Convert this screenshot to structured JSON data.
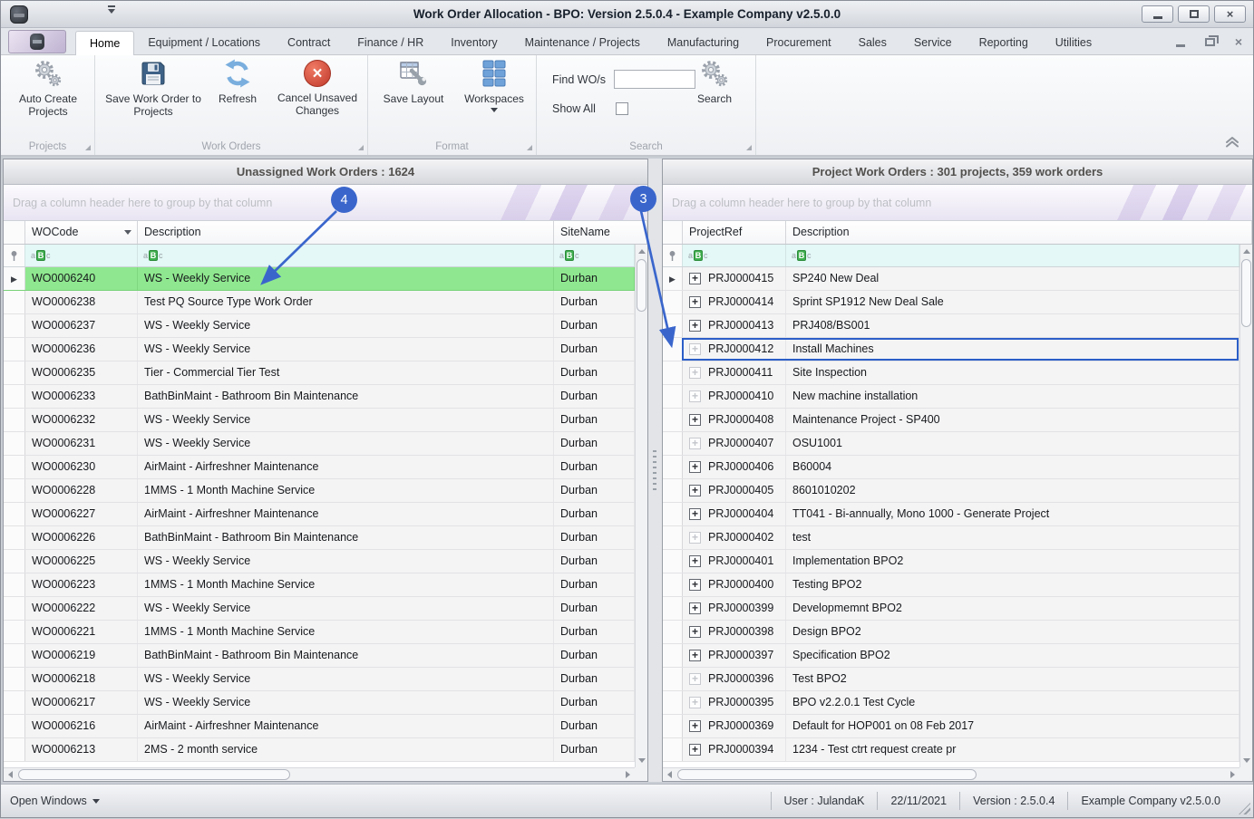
{
  "window": {
    "title": "Work Order Allocation - BPO: Version 2.5.0.4 - Example Company v2.5.0.0"
  },
  "ribbon": {
    "tabs": [
      {
        "label": "Home",
        "selected": true
      },
      {
        "label": "Equipment / Locations"
      },
      {
        "label": "Contract"
      },
      {
        "label": "Finance / HR"
      },
      {
        "label": "Inventory"
      },
      {
        "label": "Maintenance / Projects"
      },
      {
        "label": "Manufacturing"
      },
      {
        "label": "Procurement"
      },
      {
        "label": "Sales"
      },
      {
        "label": "Service"
      },
      {
        "label": "Reporting"
      },
      {
        "label": "Utilities"
      }
    ],
    "projects_group": {
      "caption": "Projects",
      "auto_create": "Auto Create Projects"
    },
    "work_orders_group": {
      "caption": "Work Orders",
      "save": "Save Work Order to Projects",
      "refresh": "Refresh",
      "cancel": "Cancel Unsaved Changes"
    },
    "format_group": {
      "caption": "Format",
      "save_layout": "Save Layout",
      "workspaces": "Workspaces"
    },
    "search_group": {
      "caption": "Search",
      "find_label": "Find WO/s",
      "find_value": "",
      "show_all_label": "Show All",
      "show_all_checked": false,
      "search": "Search"
    }
  },
  "left_panel": {
    "title": "Unassigned Work Orders : 1624",
    "group_by_hint": "Drag a column header here to group by that column",
    "columns": [
      "WOCode",
      "Description",
      "SiteName"
    ],
    "rows": [
      {
        "code": "WO0006240",
        "desc": "WS - Weekly Service",
        "site": "Durban",
        "selected": true
      },
      {
        "code": "WO0006238",
        "desc": "Test PQ Source Type Work Order",
        "site": "Durban"
      },
      {
        "code": "WO0006237",
        "desc": "WS - Weekly Service",
        "site": "Durban"
      },
      {
        "code": "WO0006236",
        "desc": "WS - Weekly Service",
        "site": "Durban"
      },
      {
        "code": "WO0006235",
        "desc": "Tier - Commercial Tier Test",
        "site": "Durban"
      },
      {
        "code": "WO0006233",
        "desc": "BathBinMaint - Bathroom Bin Maintenance",
        "site": "Durban"
      },
      {
        "code": "WO0006232",
        "desc": "WS - Weekly Service",
        "site": "Durban"
      },
      {
        "code": "WO0006231",
        "desc": "WS - Weekly Service",
        "site": "Durban"
      },
      {
        "code": "WO0006230",
        "desc": "AirMaint - Airfreshner Maintenance",
        "site": "Durban"
      },
      {
        "code": "WO0006228",
        "desc": "1MMS - 1 Month Machine Service",
        "site": "Durban"
      },
      {
        "code": "WO0006227",
        "desc": "AirMaint - Airfreshner Maintenance",
        "site": "Durban"
      },
      {
        "code": "WO0006226",
        "desc": "BathBinMaint - Bathroom Bin Maintenance",
        "site": "Durban"
      },
      {
        "code": "WO0006225",
        "desc": "WS - Weekly Service",
        "site": "Durban"
      },
      {
        "code": "WO0006223",
        "desc": "1MMS - 1 Month Machine Service",
        "site": "Durban"
      },
      {
        "code": "WO0006222",
        "desc": "WS - Weekly Service",
        "site": "Durban"
      },
      {
        "code": "WO0006221",
        "desc": "1MMS - 1 Month Machine Service",
        "site": "Durban"
      },
      {
        "code": "WO0006219",
        "desc": "BathBinMaint - Bathroom Bin Maintenance",
        "site": "Durban"
      },
      {
        "code": "WO0006218",
        "desc": "WS - Weekly Service",
        "site": "Durban"
      },
      {
        "code": "WO0006217",
        "desc": "WS - Weekly Service",
        "site": "Durban"
      },
      {
        "code": "WO0006216",
        "desc": "AirMaint - Airfreshner Maintenance",
        "site": "Durban"
      },
      {
        "code": "WO0006213",
        "desc": "2MS - 2 month service",
        "site": "Durban"
      }
    ]
  },
  "right_panel": {
    "title": "Project Work Orders : 301 projects, 359 work orders",
    "group_by_hint": "Drag a column header here to group by that column",
    "columns": [
      "ProjectRef",
      "Description"
    ],
    "rows": [
      {
        "ref": "PRJ0000415",
        "desc": "SP240 New Deal",
        "indicator": true
      },
      {
        "ref": "PRJ0000414",
        "desc": "Sprint SP1912 New Deal Sale"
      },
      {
        "ref": "PRJ0000413",
        "desc": "PRJ408/BS001"
      },
      {
        "ref": "PRJ0000412",
        "desc": "Install Machines",
        "light": true,
        "outlined": true
      },
      {
        "ref": "PRJ0000411",
        "desc": "Site Inspection",
        "light": true
      },
      {
        "ref": "PRJ0000410",
        "desc": "New machine installation",
        "light": true
      },
      {
        "ref": "PRJ0000408",
        "desc": "Maintenance Project - SP400"
      },
      {
        "ref": "PRJ0000407",
        "desc": "OSU1001",
        "light": true
      },
      {
        "ref": "PRJ0000406",
        "desc": "B60004"
      },
      {
        "ref": "PRJ0000405",
        "desc": "8601010202"
      },
      {
        "ref": "PRJ0000404",
        "desc": "TT041 - Bi-annually, Mono 1000 - Generate Project"
      },
      {
        "ref": "PRJ0000402",
        "desc": "test",
        "light": true
      },
      {
        "ref": "PRJ0000401",
        "desc": "Implementation BPO2"
      },
      {
        "ref": "PRJ0000400",
        "desc": "Testing BPO2"
      },
      {
        "ref": "PRJ0000399",
        "desc": "Developmemnt BPO2"
      },
      {
        "ref": "PRJ0000398",
        "desc": "Design BPO2"
      },
      {
        "ref": "PRJ0000397",
        "desc": "Specification BPO2"
      },
      {
        "ref": "PRJ0000396",
        "desc": "Test BPO2",
        "light": true
      },
      {
        "ref": "PRJ0000395",
        "desc": "BPO v2.2.0.1 Test Cycle",
        "light": true
      },
      {
        "ref": "PRJ0000369",
        "desc": "Default for HOP001 on 08 Feb 2017"
      },
      {
        "ref": "PRJ0000394",
        "desc": "1234 - Test ctrt request create pr"
      }
    ]
  },
  "status_bar": {
    "open_windows": "Open Windows",
    "segments": [
      {
        "label": "User : JulandaK"
      },
      {
        "label": "22/11/2021"
      },
      {
        "label": "Version : 2.5.0.4"
      },
      {
        "label": "Example Company v2.5.0.0"
      }
    ]
  },
  "annotations": {
    "callout_3": "3",
    "callout_4": "4"
  },
  "colors": {
    "accent": "#3a66cc",
    "selected_row": "#8fe88f",
    "filter_row": "#e3f8f7",
    "filter_icon": "#3fae4e",
    "drop_target_border": "#2b5ec8"
  }
}
